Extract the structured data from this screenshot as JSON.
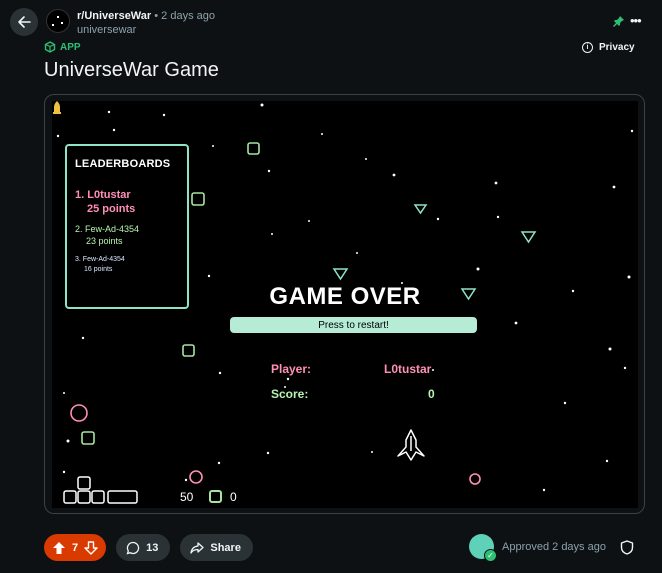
{
  "header": {
    "subreddit": "r/UniverseWar",
    "separator": "•",
    "time": "2 days ago",
    "username": "universewar",
    "app_badge": "APP",
    "privacy_label": "Privacy"
  },
  "post": {
    "title": "UniverseWar Game"
  },
  "game": {
    "leaderboard": {
      "title": "LEADERBOARDS",
      "entries": [
        {
          "rank": "1.",
          "name": "L0tustar",
          "points": "25 points"
        },
        {
          "rank": "2.",
          "name": "Few-Ad-4354",
          "points": "23 points"
        },
        {
          "rank": "3.",
          "name": "Few-Ad-4354",
          "points": "16 points"
        }
      ]
    },
    "game_over": "GAME OVER",
    "restart": "Press to restart!",
    "player_label": "Player:",
    "player_value": "L0tustar",
    "score_label": "Score:",
    "score_value": "0",
    "hud": {
      "ammo": "50",
      "gems": "0"
    },
    "colors": {
      "pink": "#ff8fb8",
      "green": "#b8f5b0",
      "teal": "#8fe3c9"
    }
  },
  "actions": {
    "upvotes": "7",
    "comments": "13",
    "share": "Share"
  },
  "moderation": {
    "status": "Approved 2 days ago"
  }
}
